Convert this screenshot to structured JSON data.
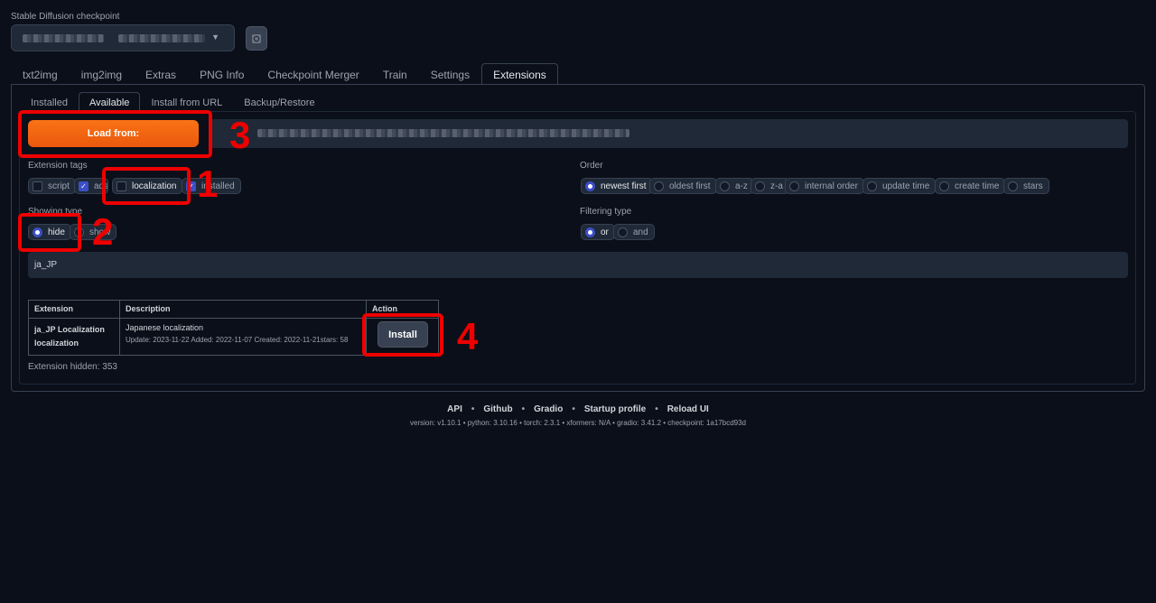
{
  "checkpoint": {
    "label": "Stable Diffusion checkpoint"
  },
  "tabs": [
    "txt2img",
    "img2img",
    "Extras",
    "PNG Info",
    "Checkpoint Merger",
    "Train",
    "Settings",
    "Extensions"
  ],
  "subtabs": [
    "Installed",
    "Available",
    "Install from URL",
    "Backup/Restore"
  ],
  "load_button": "Load from:",
  "extension_tags": {
    "label": "Extension tags",
    "items": [
      "script",
      "ads",
      "localization",
      "installed"
    ]
  },
  "order": {
    "label": "Order",
    "items": [
      "newest first",
      "oldest first",
      "a-z",
      "z-a",
      "internal order",
      "update time",
      "create time",
      "stars"
    ]
  },
  "showing_type": {
    "label": "Showing type",
    "items": [
      "hide",
      "show"
    ]
  },
  "filtering_type": {
    "label": "Filtering type",
    "items": [
      "or",
      "and"
    ]
  },
  "search_value": "ja_JP",
  "table": {
    "headers": [
      "Extension",
      "Description",
      "Action"
    ],
    "row": {
      "name_line1": "ja_JP Localization",
      "name_line2": "localization",
      "desc": "Japanese localization",
      "meta": "Update: 2023-11-22 Added: 2022-11-07 Created: 2022-11-21stars: 58",
      "action": "Install"
    }
  },
  "hidden_count": "Extension hidden: 353",
  "annotations": [
    "1",
    "2",
    "3",
    "4"
  ],
  "footer": {
    "links": [
      "API",
      "Github",
      "Gradio",
      "Startup profile",
      "Reload UI"
    ],
    "separator": "•",
    "version": "version: v1.10.1  •  python: 3.10.16  •  torch: 2.3.1  •  xformers: N/A  •  gradio: 3.41.2  •  checkpoint: 1a17bcd93d"
  },
  "colors": {
    "accent": "#3b4fc7",
    "orange": "#f97316",
    "annotation": "#ee0000",
    "bg": "#0b0f19"
  }
}
